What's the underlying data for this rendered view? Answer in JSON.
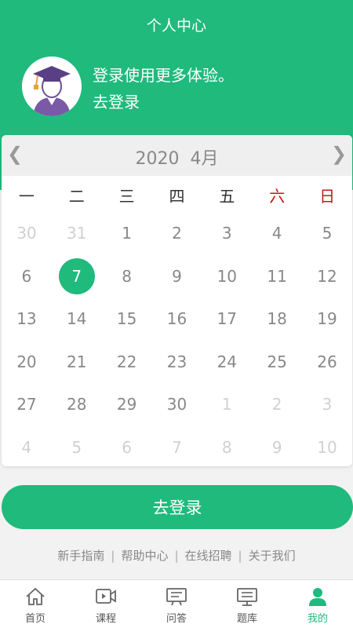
{
  "header": {
    "title": "个人中心",
    "login_prompt": "登录使用更多体验。",
    "login_link": "去登录",
    "avatar_icon": "graduate-avatar-icon"
  },
  "calendar": {
    "year": "2020",
    "month": "4月",
    "prev_icon": "❮",
    "next_icon": "❯",
    "weekdays": [
      {
        "label": "一",
        "weekend": false
      },
      {
        "label": "二",
        "weekend": false
      },
      {
        "label": "三",
        "weekend": false
      },
      {
        "label": "四",
        "weekend": false
      },
      {
        "label": "五",
        "weekend": false
      },
      {
        "label": "六",
        "weekend": true
      },
      {
        "label": "日",
        "weekend": true
      }
    ],
    "days": [
      {
        "n": "30",
        "muted": true
      },
      {
        "n": "31",
        "muted": true
      },
      {
        "n": "1"
      },
      {
        "n": "2"
      },
      {
        "n": "3"
      },
      {
        "n": "4"
      },
      {
        "n": "5"
      },
      {
        "n": "6"
      },
      {
        "n": "7",
        "selected": true
      },
      {
        "n": "8"
      },
      {
        "n": "9"
      },
      {
        "n": "10"
      },
      {
        "n": "11"
      },
      {
        "n": "12"
      },
      {
        "n": "13"
      },
      {
        "n": "14"
      },
      {
        "n": "15"
      },
      {
        "n": "16"
      },
      {
        "n": "17"
      },
      {
        "n": "18"
      },
      {
        "n": "19"
      },
      {
        "n": "20"
      },
      {
        "n": "21"
      },
      {
        "n": "22"
      },
      {
        "n": "23"
      },
      {
        "n": "24"
      },
      {
        "n": "25"
      },
      {
        "n": "26"
      },
      {
        "n": "27"
      },
      {
        "n": "28"
      },
      {
        "n": "29"
      },
      {
        "n": "30"
      },
      {
        "n": "1",
        "muted": true
      },
      {
        "n": "2",
        "muted": true
      },
      {
        "n": "3",
        "muted": true
      },
      {
        "n": "4",
        "muted": true
      },
      {
        "n": "5",
        "muted": true
      },
      {
        "n": "6",
        "muted": true
      },
      {
        "n": "7",
        "muted": true
      },
      {
        "n": "8",
        "muted": true
      },
      {
        "n": "9",
        "muted": true
      },
      {
        "n": "10",
        "muted": true
      }
    ]
  },
  "login_button": "去登录",
  "footer_links": [
    {
      "label": "新手指南",
      "name": "link-beginner-guide"
    },
    {
      "label": "帮助中心",
      "name": "link-help-center"
    },
    {
      "label": "在线招聘",
      "name": "link-online-recruitment"
    },
    {
      "label": "关于我们",
      "name": "link-about-us"
    }
  ],
  "footer_separator": "|",
  "tabs": [
    {
      "label": "首页",
      "icon": "home-icon",
      "active": false
    },
    {
      "label": "课程",
      "icon": "video-course-icon",
      "active": false
    },
    {
      "label": "问答",
      "icon": "qa-board-icon",
      "active": false
    },
    {
      "label": "题库",
      "icon": "question-bank-icon",
      "active": false
    },
    {
      "label": "我的",
      "icon": "user-profile-icon",
      "active": true
    }
  ],
  "colors": {
    "brand": "#1fba7c",
    "weekend": "#c21a1a",
    "text_muted": "#888888"
  }
}
